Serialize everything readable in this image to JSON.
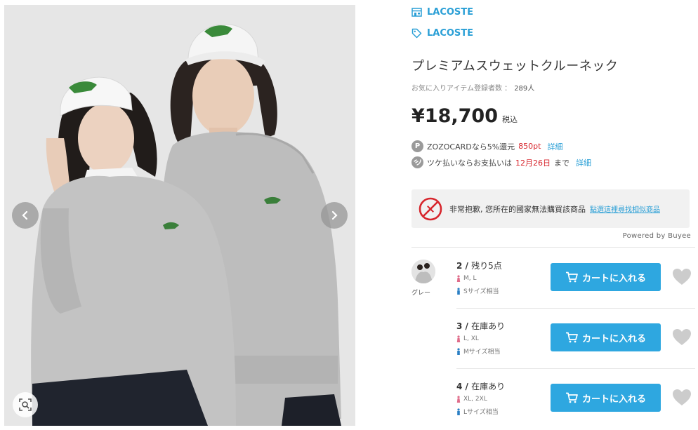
{
  "shop": {
    "name": "LACOSTE",
    "icon": "shop-icon"
  },
  "brand": {
    "name": "LACOSTE",
    "icon": "tag-icon"
  },
  "product": {
    "name": "プレミアムスウェットクルーネック",
    "favorites_label": "お気に入りアイテム登録者数 ：",
    "favorites_count": "289人",
    "price": "¥18,700",
    "tax_label": "税込"
  },
  "promos": {
    "card_icon_letter": "P",
    "card_text": "ZOZOCARDなら5%還元",
    "card_points": "850pt",
    "card_link": "詳細",
    "later_text_pre": "ツケ払いならお支払いは",
    "later_date": "12月26日",
    "later_text_post": "まで",
    "later_link": "詳細"
  },
  "buyee": {
    "message": "非常抱歉, 您所在的國家無法購買該商品",
    "link": "點選這裡尋找相似商品",
    "powered": "Powered by Buyee"
  },
  "color_swatch": {
    "name": "グレー"
  },
  "variants": [
    {
      "size_stock": "2 / ",
      "stock": "残り5点",
      "sizes": "M, L",
      "fit": "Sサイズ相当",
      "cart_label": "カートに入れる"
    },
    {
      "size_stock": "3 / ",
      "stock": "在庫あり",
      "sizes": "L, XL",
      "fit": "Mサイズ相当",
      "cart_label": "カートに入れる"
    },
    {
      "size_stock": "4 / ",
      "stock": "在庫あり",
      "sizes": "XL, 2XL",
      "fit": "Lサイズ相当",
      "cart_label": "カートに入れる"
    }
  ],
  "colors": {
    "accent": "#2ea7e0",
    "link": "#2a9fd6",
    "sale_red": "#d7262d",
    "heart_gray": "#cccccc",
    "sweatshirt_gray": "#bdbdbd",
    "lacoste_green": "#3a8a3a"
  }
}
